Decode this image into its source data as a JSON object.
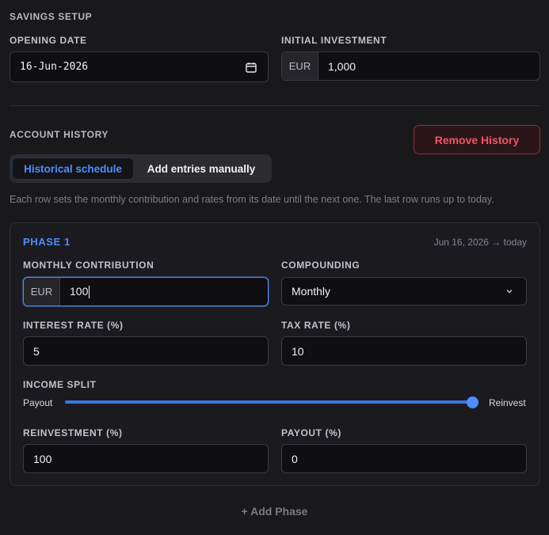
{
  "savings_setup": {
    "title": "SAVINGS SETUP",
    "opening_date_label": "OPENING DATE",
    "opening_date_value": "16-Jun-2026",
    "initial_investment_label": "INITIAL INVESTMENT",
    "initial_investment_currency": "EUR",
    "initial_investment_value": "1,000"
  },
  "account_history": {
    "title": "ACCOUNT HISTORY",
    "remove_button": "Remove History",
    "tabs": [
      {
        "label": "Historical schedule",
        "active": true
      },
      {
        "label": "Add entries manually",
        "active": false
      }
    ],
    "help_text": "Each row sets the monthly contribution and rates from its date until the next one. The last row runs up to today."
  },
  "phase": {
    "title": "PHASE 1",
    "range": "Jun 16, 2026 → today",
    "monthly_contribution_label": "MONTHLY CONTRIBUTION",
    "monthly_contribution_currency": "EUR",
    "monthly_contribution_value": "100",
    "compounding_label": "COMPOUNDING",
    "compounding_value": "Monthly",
    "interest_rate_label": "INTEREST RATE (%)",
    "interest_rate_value": "5",
    "tax_rate_label": "TAX RATE (%)",
    "tax_rate_value": "10",
    "income_split_label": "INCOME SPLIT",
    "split_left_label": "Payout",
    "split_right_label": "Reinvest",
    "split_reinvest_fraction": 1.0,
    "reinvestment_label": "REINVESTMENT (%)",
    "reinvestment_value": "100",
    "payout_label": "PAYOUT (%)",
    "payout_value": "0"
  },
  "add_phase_label": "+ Add Phase",
  "icons": {
    "calendar": "calendar-icon",
    "chevron": "chevron-down-icon"
  },
  "colors": {
    "accent": "#4f8cff",
    "danger": "#f1546a",
    "background": "#19191c"
  }
}
